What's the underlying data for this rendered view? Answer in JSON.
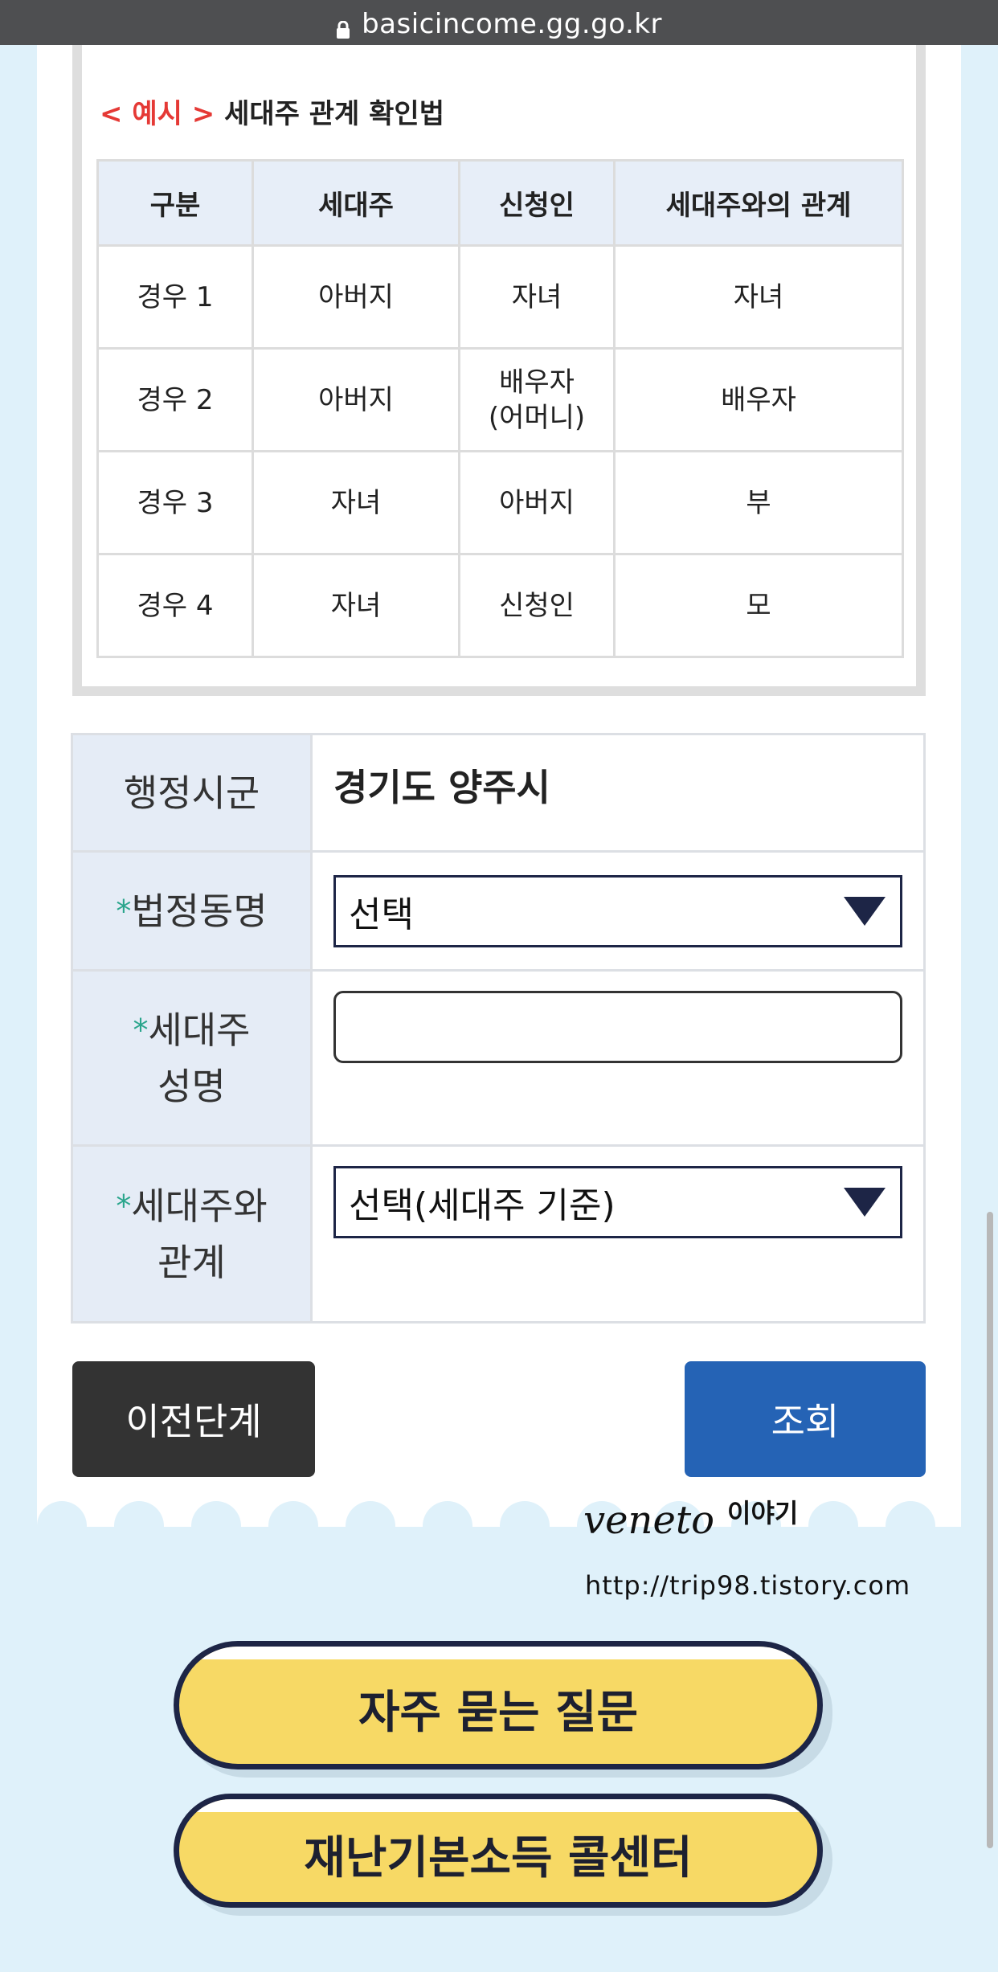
{
  "browser": {
    "url": "basicincome.gg.go.kr"
  },
  "example": {
    "prefix": "< 예시 >",
    "title": "세대주 관계 확인법",
    "headers": [
      "구분",
      "세대주",
      "신청인",
      "세대주와의 관계"
    ],
    "rows": [
      [
        "경우 1",
        "아버지",
        "자녀",
        "자녀"
      ],
      [
        "경우 2",
        "아버지",
        "배우자\n(어머니)",
        "배우자"
      ],
      [
        "경우 3",
        "자녀",
        "아버지",
        "부"
      ],
      [
        "경우 4",
        "자녀",
        "신청인",
        "모"
      ]
    ]
  },
  "form": {
    "region_label": "행정시군",
    "region_value": "경기도 양주시",
    "dong_label": "법정동명",
    "dong_selected": "선택",
    "name_label_1": "세대주",
    "name_label_2": "성명",
    "name_value": "",
    "relation_label_1": "세대주와",
    "relation_label_2": "관계",
    "relation_selected": "선택(세대주 기준)",
    "required_mark": "*"
  },
  "buttons": {
    "prev": "이전단계",
    "query": "조회"
  },
  "watermark": {
    "brand": "veneto",
    "brand_suffix": "이야기",
    "url": "http://trip98.tistory.com"
  },
  "links": {
    "faq": "자주 묻는 질문",
    "callcenter": "재난기본소득 콜센터"
  }
}
